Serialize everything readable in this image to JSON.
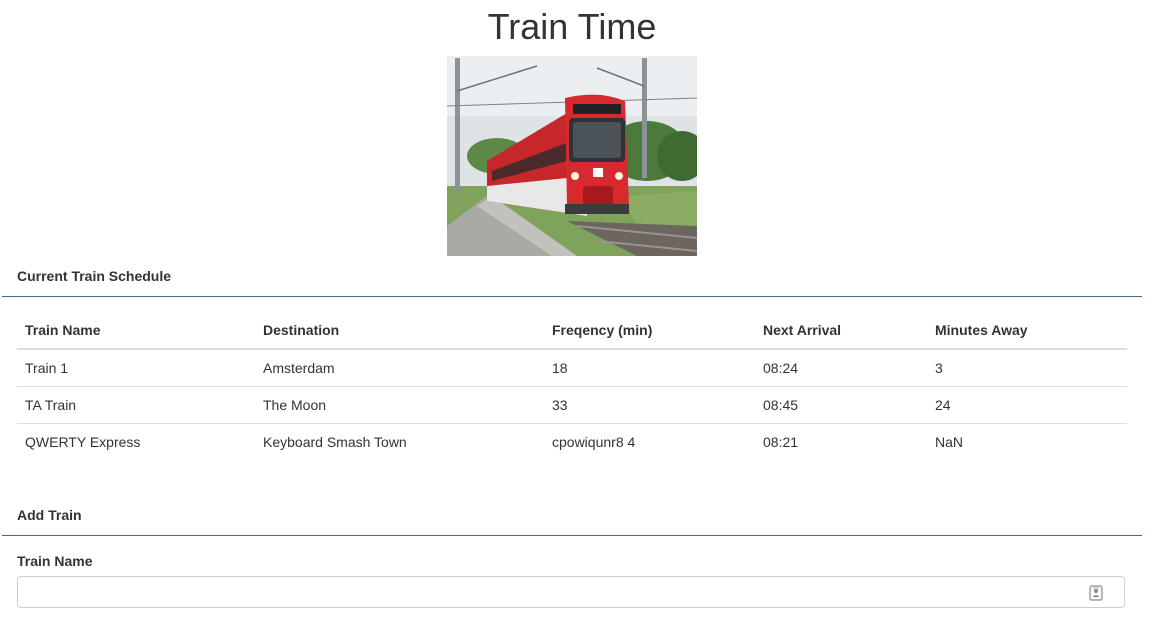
{
  "header": {
    "title": "Train Time",
    "image_icon": "train-photo"
  },
  "schedule": {
    "heading": "Current Train Schedule",
    "columns": [
      "Train Name",
      "Destination",
      "Freqency (min)",
      "Next Arrival",
      "Minutes Away"
    ],
    "rows": [
      [
        "Train 1",
        "Amsterdam",
        "18",
        "08:24",
        "3"
      ],
      [
        "TA Train",
        "The Moon",
        "33",
        "08:45",
        "24"
      ],
      [
        "QWERTY Express",
        "Keyboard Smash Town",
        "cpowiqunr8 4",
        "08:21",
        "NaN"
      ]
    ]
  },
  "add_train": {
    "heading": "Add Train",
    "train_name_label": "Train Name",
    "train_name_value": "",
    "train_name_placeholder": "",
    "input_icon": "contact-card-icon"
  },
  "colors": {
    "divider": "#3e7089",
    "text": "#333333",
    "table_border": "#dddddd"
  }
}
